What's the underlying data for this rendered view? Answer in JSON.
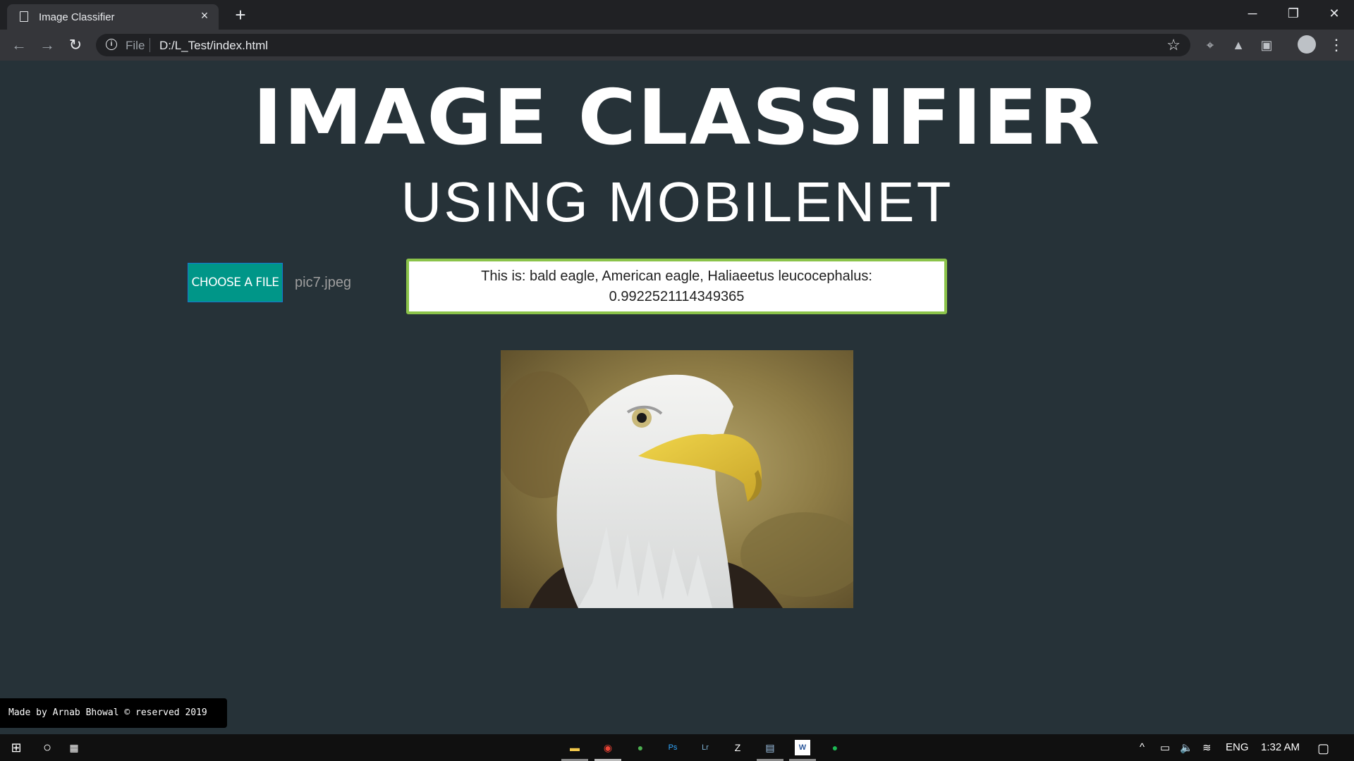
{
  "browser": {
    "tab_title": "Image Classifier",
    "tab_close": "×",
    "new_tab": "+",
    "omnibox_scheme": "File",
    "omnibox_url": "D:/L_Test/index.html",
    "window_minimize": "─",
    "window_restore": "❐",
    "window_close": "✕"
  },
  "page": {
    "title": "IMAGE CLASSIFIER",
    "subtitle": "USING MOBILENET",
    "choose_button": "CHOOSE A FILE",
    "file_name": "pic7.jpeg",
    "result_line1": "This is: bald eagle, American eagle, Haliaeetus leucocephalus:",
    "result_line2": "0.9922521114349365",
    "footer": "Made by Arnab Bhowal © reserved 2019"
  },
  "taskbar": {
    "lang": "ENG",
    "time": "1:32 AM"
  },
  "colors": {
    "background": "#263238",
    "button": "#009688",
    "result_border": "#8bc34a"
  }
}
